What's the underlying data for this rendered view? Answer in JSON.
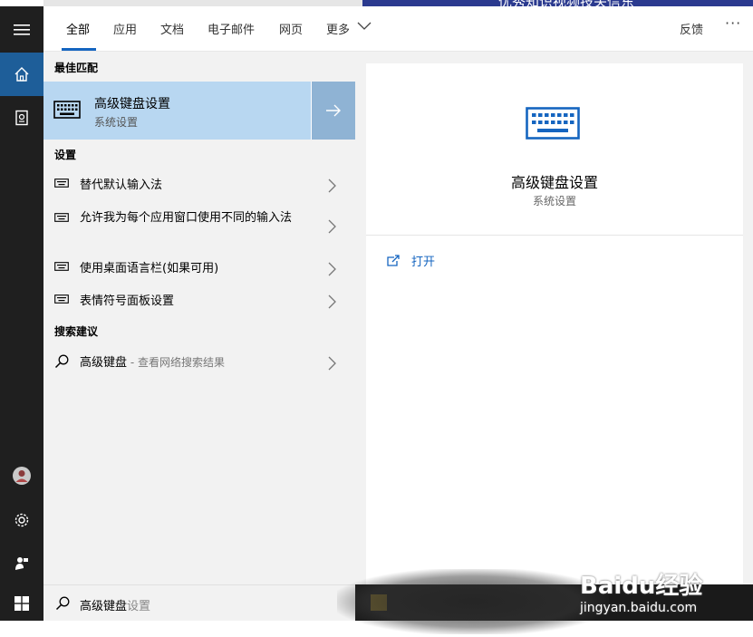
{
  "background_window": {
    "partial_title": "优秀知识视频技关信东"
  },
  "tabs": [
    {
      "label": "全部"
    },
    {
      "label": "应用"
    },
    {
      "label": "文档"
    },
    {
      "label": "电子邮件"
    },
    {
      "label": "网页"
    },
    {
      "label": "更多"
    }
  ],
  "header": {
    "feedback": "反馈",
    "more_options": "···"
  },
  "results": {
    "best_match_label": "最佳匹配",
    "best_match": {
      "title": "高级键盘设置",
      "subtitle": "系统设置"
    },
    "settings_label": "设置",
    "settings": [
      {
        "label": "替代默认输入法"
      },
      {
        "label": "允许我为每个应用窗口使用不同的输入法"
      },
      {
        "label": "使用桌面语言栏(如果可用)"
      },
      {
        "label": "表情符号面板设置"
      }
    ],
    "suggest_label": "搜索建议",
    "suggestion": {
      "query": "高级键盘",
      "hint": " - 查看网络搜索结果"
    }
  },
  "searchbox": {
    "typed": "高级键盘",
    "autocomplete": "设置"
  },
  "preview": {
    "title": "高级键盘设置",
    "subtitle": "系统设置",
    "open_label": "打开"
  },
  "watermark": {
    "main": "Baidu经验",
    "url": "jingyan.baidu.com"
  },
  "colors": {
    "accent": "#1565c0",
    "selected": "#b8d7f1",
    "rail": "#1f1f1f"
  }
}
